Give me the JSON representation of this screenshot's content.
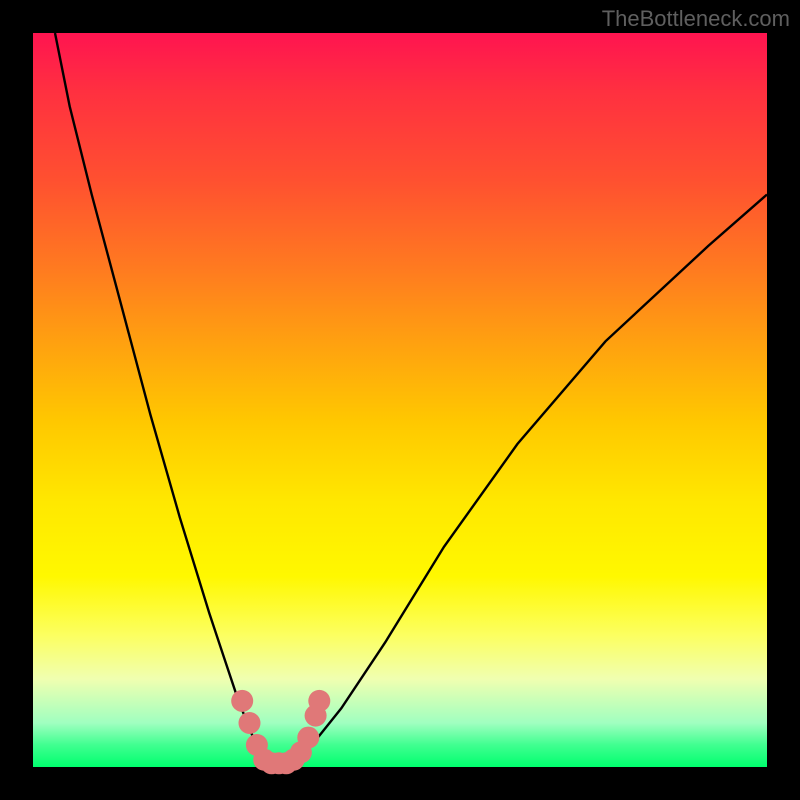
{
  "watermark": "TheBottleneck.com",
  "chart_data": {
    "type": "line",
    "title": "",
    "xlabel": "",
    "ylabel": "",
    "xlim": [
      0,
      100
    ],
    "ylim": [
      0,
      100
    ],
    "series": [
      {
        "name": "bottleneck-curve",
        "x": [
          3,
          5,
          8,
          12,
          16,
          20,
          24,
          26,
          28,
          30,
          32,
          33,
          34,
          36,
          38,
          42,
          48,
          56,
          66,
          78,
          92,
          100
        ],
        "y": [
          100,
          90,
          78,
          63,
          48,
          34,
          21,
          15,
          9,
          4,
          1,
          0,
          0,
          1,
          3,
          8,
          17,
          30,
          44,
          58,
          71,
          78
        ]
      }
    ],
    "markers": {
      "name": "highlight-points",
      "color": "#e07878",
      "points": [
        {
          "x": 28.5,
          "y": 9
        },
        {
          "x": 29.5,
          "y": 6
        },
        {
          "x": 30.5,
          "y": 3
        },
        {
          "x": 31.5,
          "y": 1
        },
        {
          "x": 32.5,
          "y": 0.5
        },
        {
          "x": 33.5,
          "y": 0.5
        },
        {
          "x": 34.5,
          "y": 0.5
        },
        {
          "x": 35.5,
          "y": 1
        },
        {
          "x": 36.5,
          "y": 2
        },
        {
          "x": 37.5,
          "y": 4
        },
        {
          "x": 38.5,
          "y": 7
        },
        {
          "x": 39.0,
          "y": 9
        }
      ]
    }
  }
}
